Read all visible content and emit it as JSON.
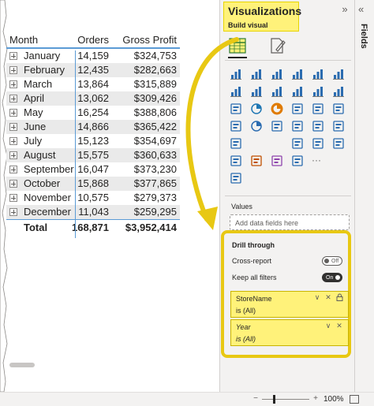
{
  "matrix": {
    "headers": {
      "month": "Month",
      "orders": "Orders",
      "gross": "Gross Profit"
    },
    "rows": [
      {
        "month": "January",
        "orders": "14,159",
        "gross": "$324,753"
      },
      {
        "month": "February",
        "orders": "12,435",
        "gross": "$282,663"
      },
      {
        "month": "March",
        "orders": "13,864",
        "gross": "$315,889"
      },
      {
        "month": "April",
        "orders": "13,062",
        "gross": "$309,426"
      },
      {
        "month": "May",
        "orders": "16,254",
        "gross": "$388,806"
      },
      {
        "month": "June",
        "orders": "14,866",
        "gross": "$365,422"
      },
      {
        "month": "July",
        "orders": "15,123",
        "gross": "$354,697"
      },
      {
        "month": "August",
        "orders": "15,575",
        "gross": "$360,633"
      },
      {
        "month": "September",
        "orders": "16,047",
        "gross": "$373,230"
      },
      {
        "month": "October",
        "orders": "15,868",
        "gross": "$377,865"
      },
      {
        "month": "November",
        "orders": "10,575",
        "gross": "$279,373"
      },
      {
        "month": "December",
        "orders": "11,043",
        "gross": "$259,295"
      }
    ],
    "total": {
      "label": "Total",
      "orders": "168,871",
      "gross": "$3,952,414"
    }
  },
  "viz_pane": {
    "title": "Visualizations",
    "subtitle": "Build visual",
    "collapse_glyph": "»",
    "tabs": [
      {
        "name": "build-visual-tab",
        "icon": "matrix-table-icon",
        "selected": true
      },
      {
        "name": "format-visual-tab",
        "icon": "paintbrush-page-icon",
        "selected": false
      }
    ],
    "more_glyph": "···",
    "values_label": "Values",
    "values_placeholder": "Add data fields here"
  },
  "drill_through": {
    "title": "Drill through",
    "cross_report_label": "Cross-report",
    "cross_report_state": "Off",
    "keep_filters_label": "Keep all filters",
    "keep_filters_state": "On",
    "filters": [
      {
        "name": "StoreName",
        "condition": "is (All)"
      },
      {
        "name": "Year",
        "condition": "is (All)"
      }
    ],
    "chevron_glyph": "∨",
    "clear_glyph": "✕"
  },
  "fields_pane": {
    "label": "Fields",
    "collapse_glyph": "«"
  },
  "statusbar": {
    "zoom_minus": "−",
    "zoom_plus": "+",
    "zoom_level": "100%"
  },
  "colors": {
    "highlight_yellow": "#fff27a",
    "callout_yellow": "#e8c813",
    "matrix_accent": "#5b9bd5",
    "pane_bg": "#f3f2f1",
    "row_band": "#eaeaea"
  }
}
